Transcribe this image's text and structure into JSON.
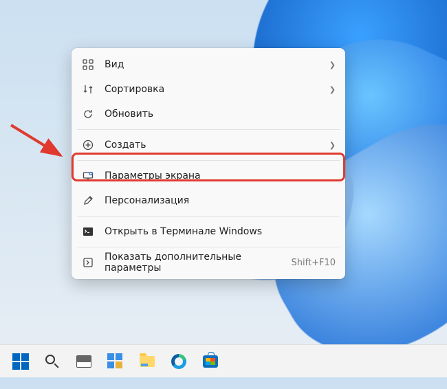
{
  "context_menu": {
    "view": {
      "label": "Вид",
      "has_submenu": true
    },
    "sort": {
      "label": "Сортировка",
      "has_submenu": true
    },
    "refresh": {
      "label": "Обновить"
    },
    "new": {
      "label": "Создать",
      "has_submenu": true
    },
    "display": {
      "label": "Параметры экрана"
    },
    "personalize": {
      "label": "Персонализация"
    },
    "terminal": {
      "label": "Открыть в Терминале Windows"
    },
    "more": {
      "label": "Показать дополнительные параметры",
      "shortcut": "Shift+F10"
    }
  },
  "annotation": {
    "highlighted_item": "display",
    "arrow_color": "#e03a2f"
  },
  "taskbar": {
    "items": [
      "start",
      "search",
      "task-view",
      "widgets",
      "file-explorer",
      "edge",
      "microsoft-store"
    ]
  }
}
